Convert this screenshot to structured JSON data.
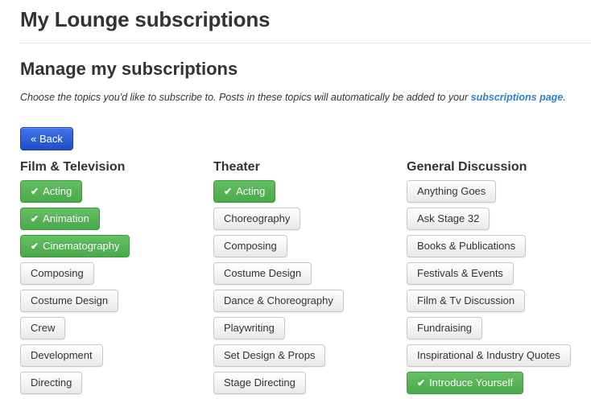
{
  "page": {
    "title": "My Lounge subscriptions",
    "section_title": "Manage my subscriptions",
    "intro_text": "Choose the topics you'd like to subscribe to. Posts in these topics will automatically be added to your ",
    "intro_link": "subscriptions page",
    "intro_end": ".",
    "back_label": "« Back"
  },
  "colors": {
    "subscribed": "#5cb85c",
    "primary": "#2a5bd7",
    "link": "#2a7fd0"
  },
  "columns": [
    {
      "title": "Film & Television",
      "topics": [
        {
          "label": "Acting",
          "subscribed": true
        },
        {
          "label": "Animation",
          "subscribed": true
        },
        {
          "label": "Cinematography",
          "subscribed": true
        },
        {
          "label": "Composing",
          "subscribed": false
        },
        {
          "label": "Costume Design",
          "subscribed": false
        },
        {
          "label": "Crew",
          "subscribed": false
        },
        {
          "label": "Development",
          "subscribed": false
        },
        {
          "label": "Directing",
          "subscribed": false
        }
      ]
    },
    {
      "title": "Theater",
      "topics": [
        {
          "label": "Acting",
          "subscribed": true
        },
        {
          "label": "Choreography",
          "subscribed": false
        },
        {
          "label": "Composing",
          "subscribed": false
        },
        {
          "label": "Costume Design",
          "subscribed": false
        },
        {
          "label": "Dance & Choreography",
          "subscribed": false
        },
        {
          "label": "Playwriting",
          "subscribed": false
        },
        {
          "label": "Set Design & Props",
          "subscribed": false
        },
        {
          "label": "Stage Directing",
          "subscribed": false
        }
      ]
    },
    {
      "title": "General Discussion",
      "topics": [
        {
          "label": "Anything Goes",
          "subscribed": false
        },
        {
          "label": "Ask Stage 32",
          "subscribed": false
        },
        {
          "label": "Books & Publications",
          "subscribed": false
        },
        {
          "label": "Festivals & Events",
          "subscribed": false
        },
        {
          "label": "Film & Tv Discussion",
          "subscribed": false
        },
        {
          "label": "Fundraising",
          "subscribed": false
        },
        {
          "label": "Inspirational & Industry Quotes",
          "subscribed": false
        },
        {
          "label": "Introduce Yourself",
          "subscribed": true
        }
      ]
    }
  ]
}
